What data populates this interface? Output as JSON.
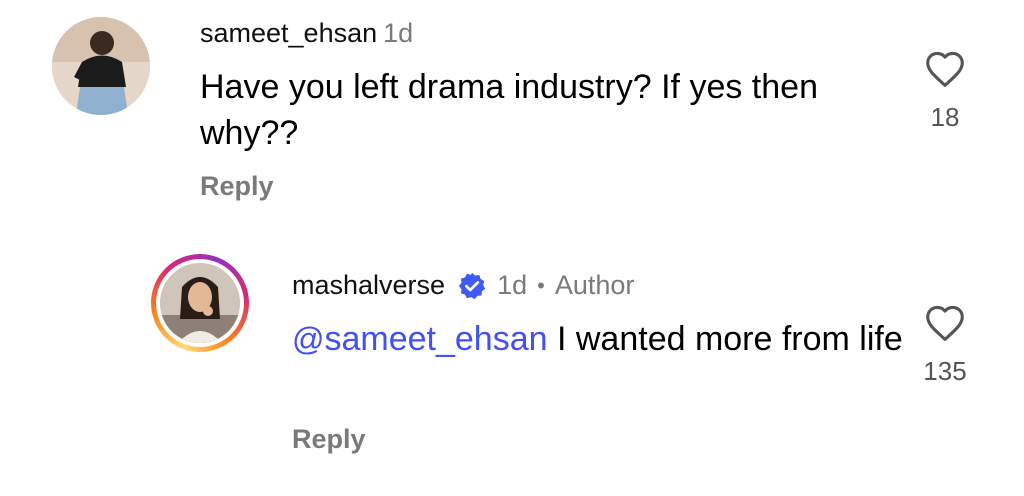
{
  "comments": [
    {
      "username": "sameet_ehsan",
      "time": "1d",
      "text": "Have you left drama industry? If yes then why??",
      "reply_label": "Reply",
      "like_count": "18",
      "avatar_icon": "user-avatar-photo"
    },
    {
      "username": "mashalverse",
      "verified_icon": "verified-badge-icon",
      "time": "1d",
      "separator": "•",
      "author_label": "Author",
      "mention_icon": "@",
      "mention": "sameet_ehsan",
      "text": " I wanted more from life",
      "reply_label": "Reply",
      "like_count": "135",
      "avatar_icon": "author-avatar-photo"
    }
  ],
  "colors": {
    "mention": "#4150f7",
    "verified": "#3e5bf6",
    "muted_text": "#7a7a7a"
  }
}
